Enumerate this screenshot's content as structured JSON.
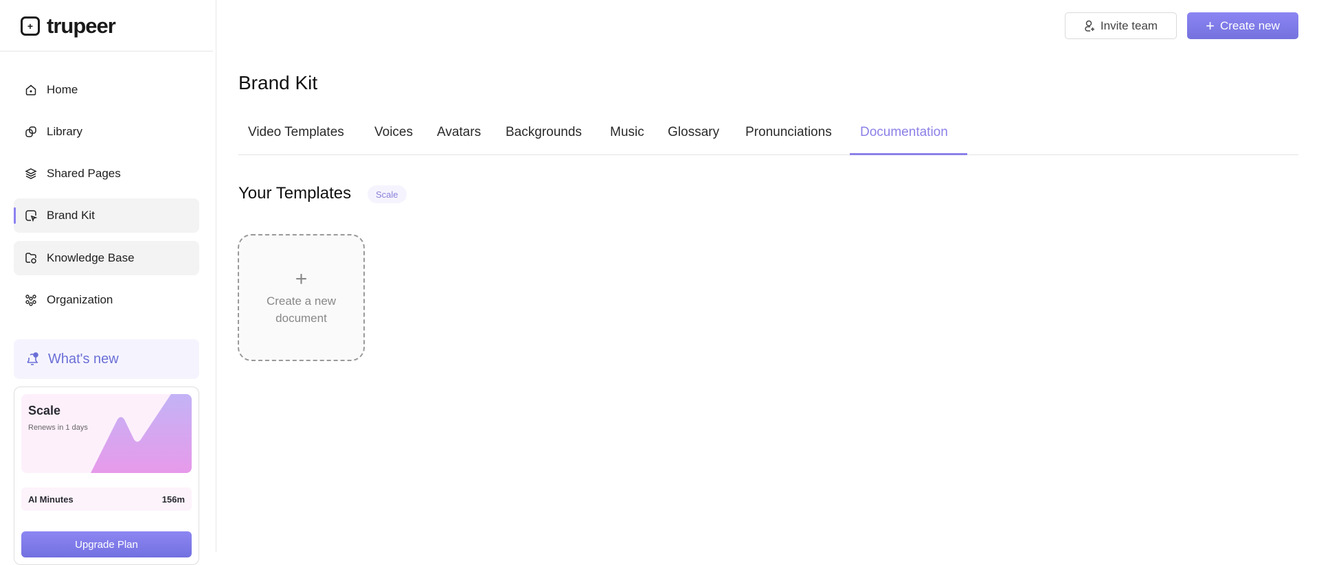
{
  "brand": {
    "name": "trupeer"
  },
  "sidebar": {
    "items": [
      {
        "label": "Home",
        "icon": "home-icon"
      },
      {
        "label": "Library",
        "icon": "library-icon"
      },
      {
        "label": "Shared Pages",
        "icon": "layers-icon"
      },
      {
        "label": "Brand Kit",
        "icon": "brand-kit-icon",
        "active": true
      },
      {
        "label": "Knowledge Base",
        "icon": "folder-icon"
      },
      {
        "label": "Organization",
        "icon": "organization-icon"
      }
    ],
    "whats_new": "What's new",
    "plan": {
      "name": "Scale",
      "renews": "Renews in 1 days",
      "minutes_label": "AI Minutes",
      "minutes_value": "156m",
      "upgrade": "Upgrade Plan"
    }
  },
  "header": {
    "invite": "Invite team",
    "create": "Create new"
  },
  "main": {
    "title": "Brand Kit",
    "tabs": [
      "Video Templates",
      "Voices",
      "Avatars",
      "Backgrounds",
      "Music",
      "Glossary",
      "Pronunciations",
      "Documentation"
    ],
    "active_tab": "Documentation",
    "section_title": "Your Templates",
    "section_badge": "Scale",
    "new_card": {
      "plus": "+",
      "line1": "Create a new",
      "line2": "document"
    }
  },
  "colors": {
    "accent": "#8b80e8",
    "button": "#7b78e6"
  }
}
